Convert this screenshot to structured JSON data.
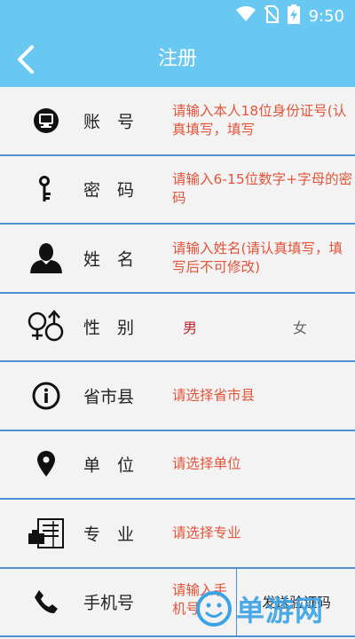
{
  "status_bar": {
    "time": "9:50",
    "icons": [
      "wifi-icon",
      "no-sim-icon",
      "battery-charging-icon"
    ]
  },
  "app_bar": {
    "title": "注册",
    "back_icon": "chevron-left-icon"
  },
  "colors": {
    "accent": "#69c8f2",
    "divider": "#4e90cf",
    "hint": "#e2553a",
    "male": "#b9272a",
    "background": "#f3f3f3"
  },
  "form": {
    "account": {
      "icon": "monitor-badge-icon",
      "label": "账　号",
      "hint": "请输入本人18位身份证号(认真填写，填写"
    },
    "password": {
      "icon": "key-icon",
      "label": "密　码",
      "hint": "请输入6-15位数字+字母的密码"
    },
    "name": {
      "icon": "person-icon",
      "label": "姓　名",
      "hint": "请输入姓名(请认真填写，填写后不可修改)"
    },
    "gender": {
      "icon": "gender-icon",
      "label": "性　别",
      "male": "男",
      "female": "女"
    },
    "region": {
      "icon": "info-icon",
      "label": "省市县",
      "hint": "请选择省市县"
    },
    "unit": {
      "icon": "location-pin-icon",
      "label": "单　位",
      "hint": "请选择单位"
    },
    "major": {
      "icon": "document-icon",
      "label": "专　业",
      "hint": "请选择专业"
    },
    "phone": {
      "icon": "phone-icon",
      "label": "手机号",
      "hint": "请输入手机号",
      "send_code": "发送验证码"
    }
  },
  "watermark": {
    "text": "单游网"
  }
}
